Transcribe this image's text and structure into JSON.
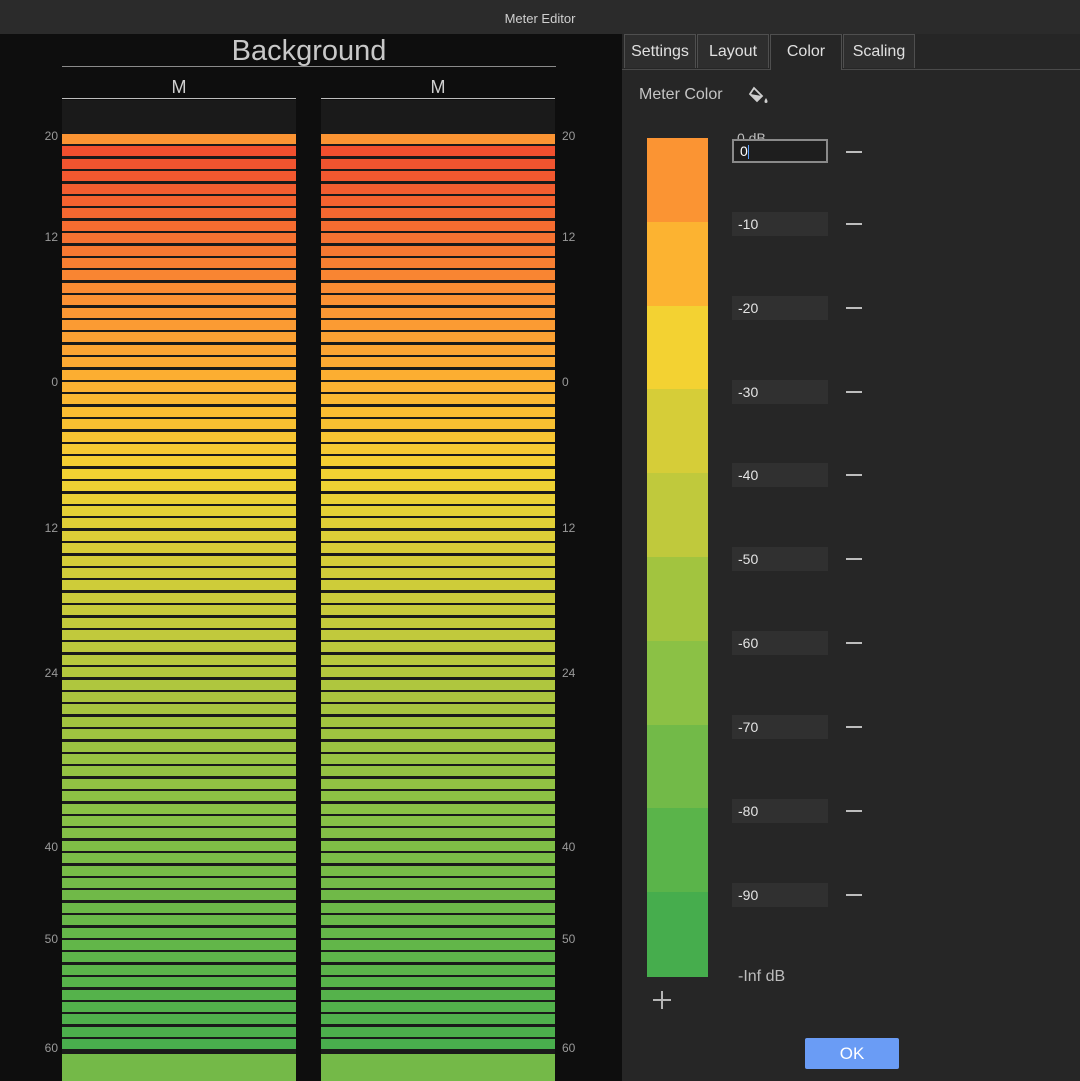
{
  "window": {
    "title": "Meter Editor"
  },
  "meter": {
    "title": "Background",
    "channels": [
      {
        "label": "M"
      },
      {
        "label": "M"
      }
    ],
    "scale_left": [
      "20",
      "12",
      "0",
      "12",
      "24",
      "40",
      "50",
      "60"
    ],
    "scale_right": [
      "20",
      "12",
      "0",
      "12",
      "24",
      "40",
      "50",
      "60"
    ]
  },
  "tabs": [
    {
      "label": "Settings"
    },
    {
      "label": "Layout"
    },
    {
      "label": "Color"
    },
    {
      "label": "Scaling"
    }
  ],
  "active_tab": "Color",
  "color_panel": {
    "meter_color_label": "Meter Color",
    "paint_bucket_icon": "paint-bucket-icon",
    "top_label": "0 dB",
    "editing_value": "0",
    "stops": [
      {
        "db": "0",
        "color": "#fb9433"
      },
      {
        "db": "-10",
        "color": "#fcb331"
      },
      {
        "db": "-20",
        "color": "#f3d232"
      },
      {
        "db": "-30",
        "color": "#d6cd38"
      },
      {
        "db": "-40",
        "color": "#c0c93c"
      },
      {
        "db": "-50",
        "color": "#a2c43f"
      },
      {
        "db": "-60",
        "color": "#8bc145"
      },
      {
        "db": "-70",
        "color": "#72ba48"
      },
      {
        "db": "-80",
        "color": "#5ab44a"
      },
      {
        "db": "-90",
        "color": "#46ad4d"
      }
    ],
    "bottom_label": "-Inf dB",
    "add_icon": "plus-icon",
    "remove_icon": "minus-icon"
  },
  "ok_button": "OK"
}
